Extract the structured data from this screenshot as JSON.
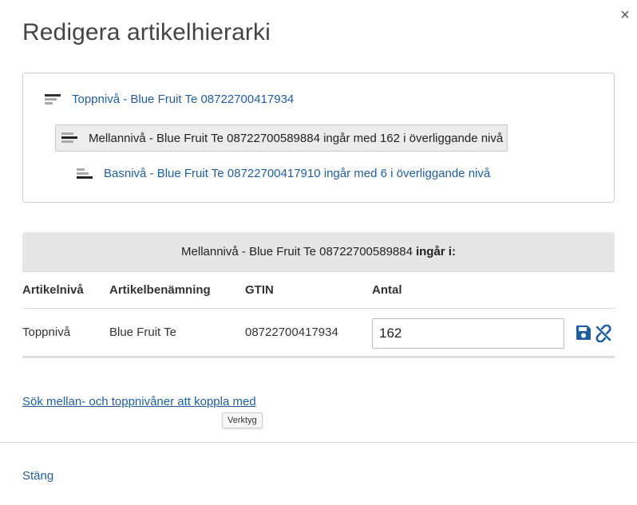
{
  "dialog": {
    "title": "Redigera artikelhierarki",
    "close_icon": "close-icon",
    "close_glyph": "×"
  },
  "hierarchy": {
    "top": {
      "text": "Toppnivå - Blue Fruit Te 08722700417934",
      "icon": "top-level-icon"
    },
    "mid": {
      "text": "Mellannivå - Blue Fruit Te 08722700589884 ingår med 162 i överliggande nivå",
      "icon": "mid-level-icon"
    },
    "base": {
      "text": "Basnivå - Blue Fruit Te 08722700417910 ingår med 6 i överliggande nivå",
      "icon": "base-level-icon"
    }
  },
  "includes": {
    "item": "Mellannivå - Blue Fruit Te 08722700589884",
    "suffix": "ingår i:"
  },
  "table": {
    "headers": [
      "Artikelnivå",
      "Artikelbenämning",
      "GTIN",
      "Antal"
    ],
    "rows": [
      {
        "level": "Toppnivå",
        "name": "Blue Fruit Te",
        "gtin": "08722700417934",
        "quantity": "162"
      }
    ]
  },
  "search_link": "Sök mellan- och toppnivåner att koppla med",
  "tooltip": "Verktyg",
  "footer": {
    "close_label": "Stäng"
  },
  "colors": {
    "link": "#1f5fa0",
    "icon": "#1f5fa0",
    "header_bg": "#e6e6e6"
  }
}
